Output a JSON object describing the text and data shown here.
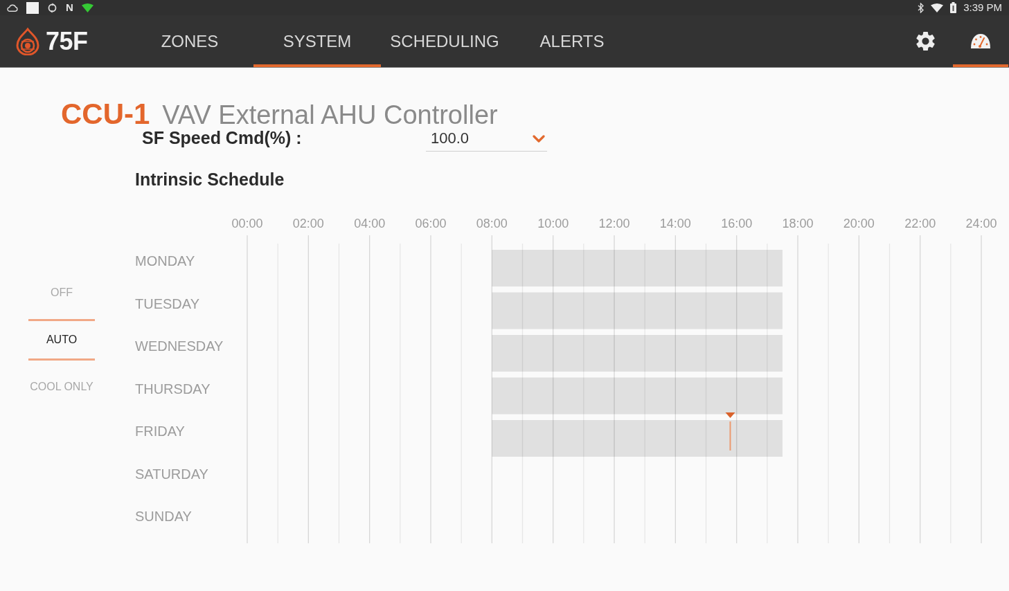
{
  "status_bar": {
    "nfc_glyph": "N",
    "time": "3:39 PM"
  },
  "nav": {
    "logo": {
      "text": "75F"
    },
    "tabs": [
      {
        "label": "ZONES",
        "selected": false
      },
      {
        "label": "SYSTEM",
        "selected": true
      },
      {
        "label": "SCHEDULING",
        "selected": false
      },
      {
        "label": "ALERTS",
        "selected": false
      }
    ],
    "icon_tabs": [
      {
        "kind": "settings",
        "selected": false
      },
      {
        "kind": "dashboard",
        "selected": true
      }
    ]
  },
  "header": {
    "device": "CCU-1",
    "title": "VAV External AHU Controller"
  },
  "speed_field": {
    "label": "SF Speed Cmd(%) :",
    "value": "100.0"
  },
  "schedule": {
    "title": "Intrinsic Schedule",
    "modes": [
      {
        "label": "OFF",
        "selected": false
      },
      {
        "label": "AUTO",
        "selected": true
      },
      {
        "label": "COOL ONLY",
        "selected": false
      }
    ],
    "time_labels": [
      "00:00",
      "02:00",
      "04:00",
      "06:00",
      "08:00",
      "10:00",
      "12:00",
      "14:00",
      "16:00",
      "18:00",
      "20:00",
      "22:00",
      "24:00"
    ],
    "days": [
      {
        "label": "MONDAY",
        "scheduled": true
      },
      {
        "label": "TUESDAY",
        "scheduled": true
      },
      {
        "label": "WEDNESDAY",
        "scheduled": true
      },
      {
        "label": "THURSDAY",
        "scheduled": true
      },
      {
        "label": "FRIDAY",
        "scheduled": true,
        "now": {
          "level": 0.658
        }
      },
      {
        "label": "SATURDAY",
        "scheduled": false
      },
      {
        "label": "SUNDAY",
        "scheduled": false
      }
    ]
  }
}
